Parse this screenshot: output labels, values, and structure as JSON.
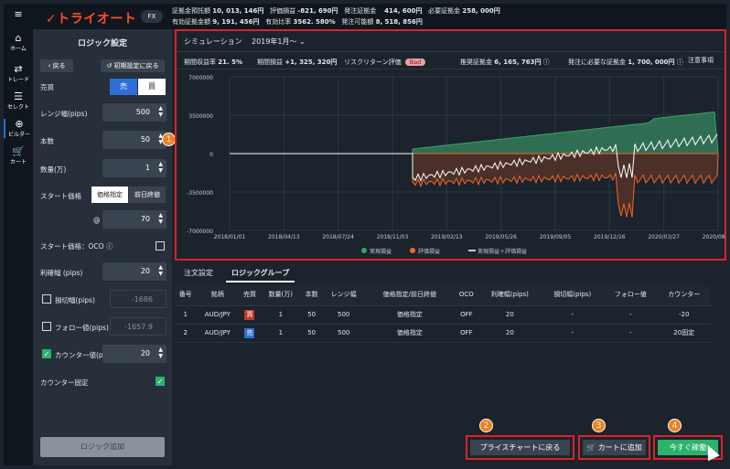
{
  "sidebar": {
    "items": [
      {
        "label": "ホーム",
        "icon": "home-icon"
      },
      {
        "label": "トレード",
        "icon": "trade-icon"
      },
      {
        "label": "セレクト",
        "icon": "select-icon"
      },
      {
        "label": "ビルダー",
        "icon": "builder-icon"
      },
      {
        "label": "カート",
        "icon": "cart-icon"
      }
    ]
  },
  "header": {
    "logo": "トライオート",
    "fx": "FX",
    "row1": [
      "証拠金預託額",
      "10, 013, 146円",
      "評価損益",
      "-821, 690円",
      "発注証拠金",
      "414, 600円",
      "必要証拠金",
      "258, 000円"
    ],
    "row2": [
      "有効証拠金額",
      "9, 191, 456円",
      "有効比率",
      "3562. 580%",
      "発注可能額",
      "8, 518, 856円"
    ]
  },
  "logic": {
    "title": "ロジック設定",
    "back": "戻る",
    "reset": "初期設定に戻る",
    "side_label": "売買",
    "sell": "売",
    "buy": "買",
    "range_label": "レンジ幅(pips)",
    "range_value": "500",
    "count_label": "本数",
    "count_value": "50",
    "qty_label": "数量(万)",
    "qty_value": "1",
    "start_label": "スタート価格",
    "price_mode": "価格指定",
    "prev_close": "前日終値",
    "at": "@",
    "start_value": "70",
    "oco_label": "スタート価格：OCO",
    "profit_label": "利確幅 (pips)",
    "profit_value": "20",
    "stop_label": "損切幅(pips)",
    "stop_value": "-1686",
    "follow_label": "フォロー値(pips)",
    "follow_value": "-1657.9",
    "counter_label": "カウンター値(pips)",
    "counter_value": "20",
    "counter_fixed": "カウンター固定",
    "add": "ロジック追加"
  },
  "sim": {
    "title": "シミュレーション",
    "period": "2019年1月～",
    "annual_label": "期間収益率",
    "annual": "21. 5%",
    "pl_label": "期間損益",
    "pl": "+1, 325, 320円",
    "risk_label": "リスクリターン評価",
    "risk": "Bad",
    "rec_label": "推奨証拠金",
    "rec": "6, 165, 763円",
    "need_label": "発注に必要な証拠金",
    "need": "1, 700, 000円",
    "notes": "注意事項"
  },
  "chart_data": {
    "type": "area",
    "yticks": [
      "7000000",
      "3500000",
      "0",
      "-3500000",
      "-7000000"
    ],
    "xticks": [
      "2018/01/01",
      "2018/04/13",
      "2018/07/24",
      "2018/11/03",
      "2019/02/13",
      "2019/05/26",
      "2019/09/05",
      "2019/12/16",
      "2020/03/27",
      "2020/08/23"
    ],
    "series": [
      {
        "name": "実現損益",
        "color": "#3aa36a"
      },
      {
        "name": "評価損益",
        "color": "#f0672a"
      },
      {
        "name": "実現損益＋評価損益",
        "color": "#ffffff"
      }
    ]
  },
  "tabs": {
    "order": "注文設定",
    "group": "ロジックグループ"
  },
  "table": {
    "headers": [
      "番号",
      "銘柄",
      "売買",
      "数量(万)",
      "本数",
      "レンジ幅",
      "価格指定/前日終値",
      "OCO",
      "利確幅(pips)",
      "損切幅(pips)",
      "フォロー値",
      "カウンター"
    ],
    "rows": [
      [
        "1",
        "AUD/JPY",
        "買",
        "1",
        "50",
        "500",
        "価格指定",
        "OFF",
        "20",
        "-",
        "-",
        "-20"
      ],
      [
        "2",
        "AUD/JPY",
        "売",
        "1",
        "50",
        "500",
        "価格指定",
        "OFF",
        "20",
        "-",
        "-",
        "20固定"
      ]
    ]
  },
  "buttons": {
    "back_chart": "プライスチャートに戻る",
    "add_cart": "カートに追加",
    "run_now": "今すぐ稼働"
  },
  "callouts": [
    "1",
    "2",
    "3",
    "4"
  ]
}
